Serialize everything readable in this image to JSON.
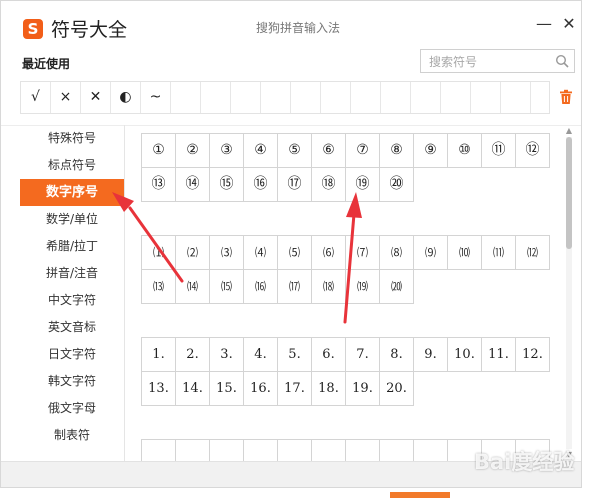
{
  "window": {
    "title": "符号大全",
    "subtitle": "搜狗拼音输入法",
    "logo_char": "S",
    "minimize": "—",
    "close": "✕"
  },
  "recent": {
    "label": "最近使用",
    "items": [
      "√",
      "×",
      "✕",
      "◐",
      "~",
      "",
      "",
      "",
      "",
      "",
      "",
      "",
      "",
      "",
      "",
      "",
      ""
    ]
  },
  "search": {
    "placeholder": "搜索符号"
  },
  "categories": [
    "特殊符号",
    "标点符号",
    "数字序号",
    "数学/单位",
    "希腊/拉丁",
    "拼音/注音",
    "中文字符",
    "英文音标",
    "日文字符",
    "韩文字符",
    "俄文字母",
    "制表符"
  ],
  "active_category": "数字序号",
  "symbols": {
    "circled": [
      "①",
      "②",
      "③",
      "④",
      "⑤",
      "⑥",
      "⑦",
      "⑧",
      "⑨",
      "⑩",
      "⑪",
      "⑫",
      "⑬",
      "⑭",
      "⑮",
      "⑯",
      "⑰",
      "⑱",
      "⑲",
      "⑳"
    ],
    "parenthesized": [
      "⑴",
      "⑵",
      "⑶",
      "⑷",
      "⑸",
      "⑹",
      "⑺",
      "⑻",
      "⑼",
      "⑽",
      "⑾",
      "⑿",
      "⒀",
      "⒁",
      "⒂",
      "⒃",
      "⒄",
      "⒅",
      "⒆",
      "⒇"
    ],
    "dotted": [
      "1.",
      "2.",
      "3.",
      "4.",
      "5.",
      "6.",
      "7.",
      "8.",
      "9.",
      "10.",
      "11.",
      "12.",
      "13.",
      "14.",
      "15.",
      "16.",
      "17.",
      "18.",
      "19.",
      "20."
    ],
    "partial": [
      "",
      "",
      "",
      "",
      "",
      "",
      "",
      "",
      "",
      "",
      "",
      ""
    ]
  },
  "watermark": "Bai度经验",
  "colors": {
    "accent": "#f46a1f",
    "arrow": "#e8333a"
  }
}
